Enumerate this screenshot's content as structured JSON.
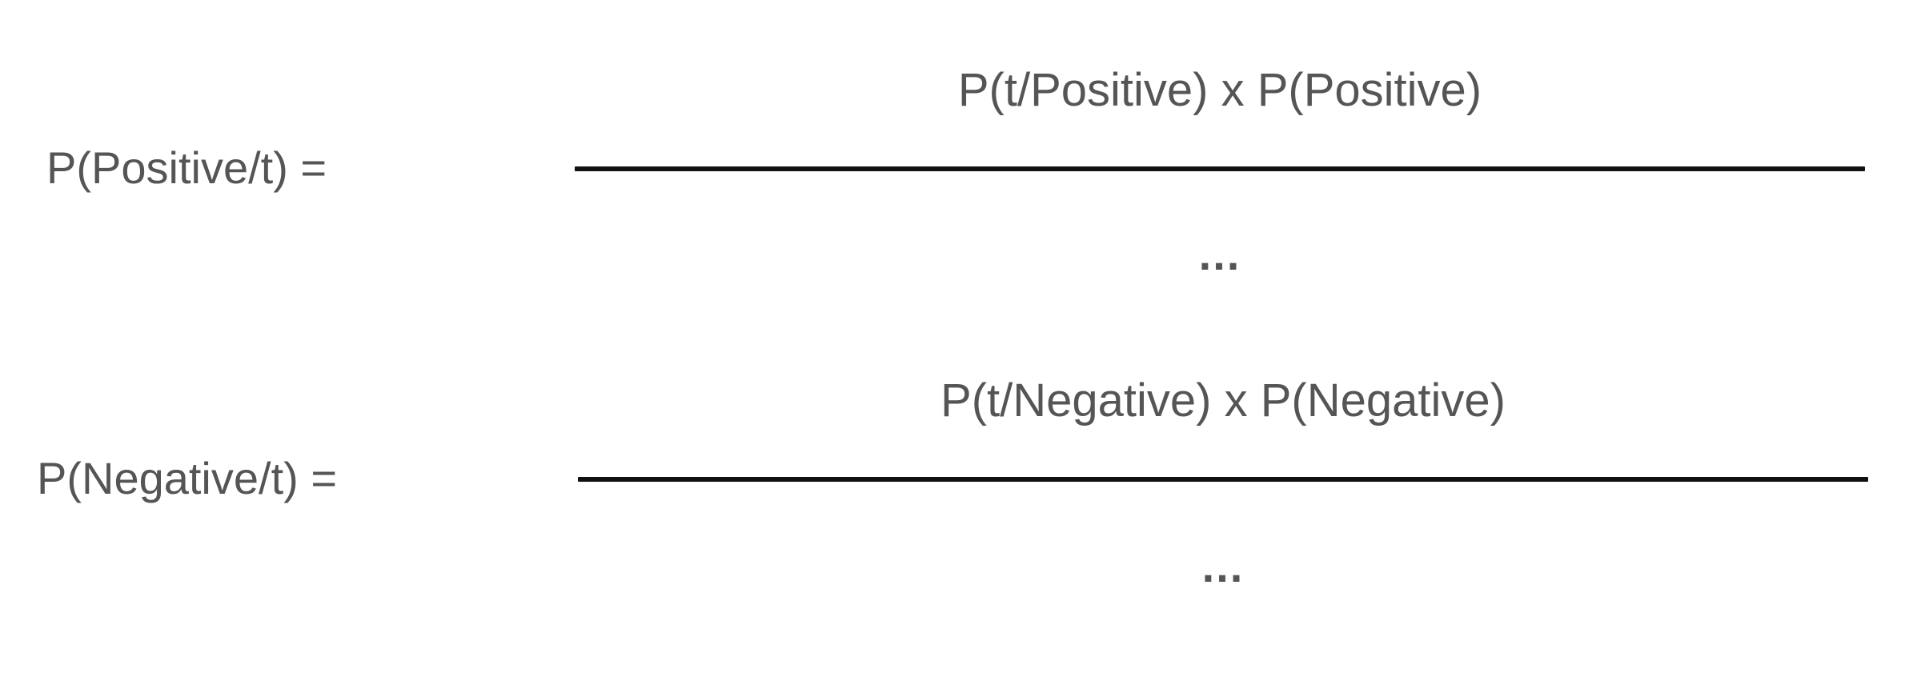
{
  "equations": [
    {
      "lhs": "P(Positive/t) =",
      "numerator": "P(t/Positive) x P(Positive)",
      "denominator": "..."
    },
    {
      "lhs": "P(Negative/t) =",
      "numerator": "P(t/Negative) x P(Negative)",
      "denominator": "..."
    }
  ],
  "colors": {
    "text": "#555555",
    "fraction_bar": "#111111",
    "background": "#ffffff"
  }
}
